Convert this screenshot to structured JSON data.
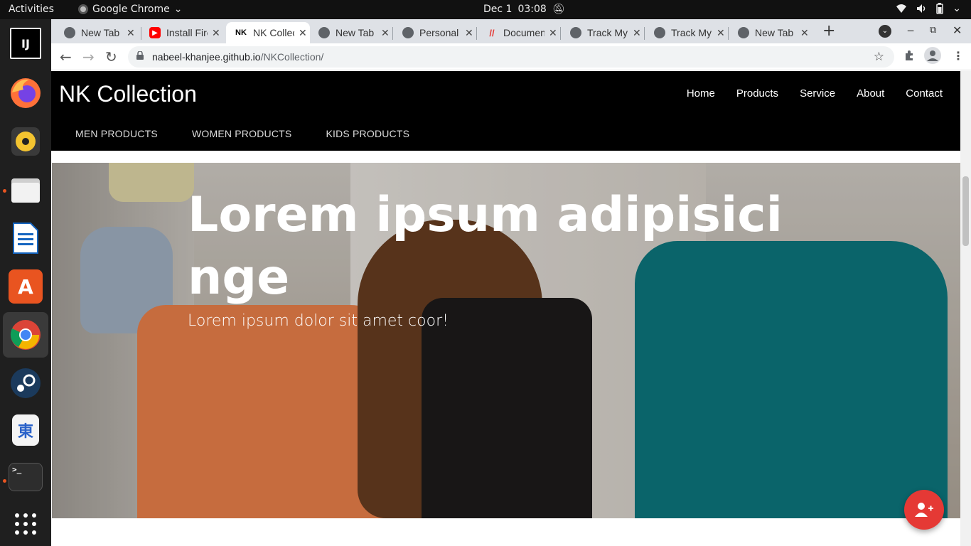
{
  "system": {
    "activities": "Activities",
    "app_name": "Google Chrome",
    "date": "Dec 1",
    "time": "03:08"
  },
  "dock": {
    "items": [
      {
        "name": "IntelliJ IDEA",
        "icon": "intellij-icon",
        "glyph": "IJ"
      },
      {
        "name": "Firefox",
        "icon": "firefox-icon"
      },
      {
        "name": "Rhythmbox",
        "icon": "rhythmbox-icon"
      },
      {
        "name": "Files",
        "icon": "files-icon"
      },
      {
        "name": "LibreOffice Writer",
        "icon": "writer-icon"
      },
      {
        "name": "Ubuntu Software",
        "icon": "software-icon",
        "glyph": "A"
      },
      {
        "name": "Google Chrome",
        "icon": "chrome-icon"
      },
      {
        "name": "Steam",
        "icon": "steam-icon"
      },
      {
        "name": "Input Method",
        "icon": "input-method-icon",
        "glyph": "東"
      },
      {
        "name": "Terminal",
        "icon": "terminal-icon",
        "glyph": ">_"
      },
      {
        "name": "Show Applications",
        "icon": "app-grid-icon"
      }
    ]
  },
  "browser": {
    "tabs": [
      {
        "title": "New Tab",
        "icon": "chrome-favicon"
      },
      {
        "title": "Install Firefox",
        "icon": "youtube-favicon"
      },
      {
        "title": "NK Collection",
        "icon": "nk-favicon",
        "active": true
      },
      {
        "title": "New Tab",
        "icon": "chrome-favicon"
      },
      {
        "title": "Personal",
        "icon": "chrome-favicon"
      },
      {
        "title": "Documents",
        "icon": "docs-favicon"
      },
      {
        "title": "Track My",
        "icon": "chrome-favicon"
      },
      {
        "title": "Track My",
        "icon": "chrome-favicon"
      },
      {
        "title": "New Tab",
        "icon": "chrome-favicon"
      }
    ],
    "url_host": "nabeel-khanjee.github.io",
    "url_path": "/NKCollection/"
  },
  "site": {
    "brand": "NK Collection",
    "nav": [
      "Home",
      "Products",
      "Service",
      "About",
      "Contact"
    ],
    "subnav": [
      "MEN PRODUCTS",
      "WOMEN PRODUCTS",
      "KIDS PRODUCTS"
    ],
    "hero": {
      "title": "Lorem ipsum adipisicinge",
      "subtitle": "Lorem ipsum dolor sit amet coor!"
    },
    "fab_icon": "add-user-icon",
    "accent": "#e53935"
  }
}
